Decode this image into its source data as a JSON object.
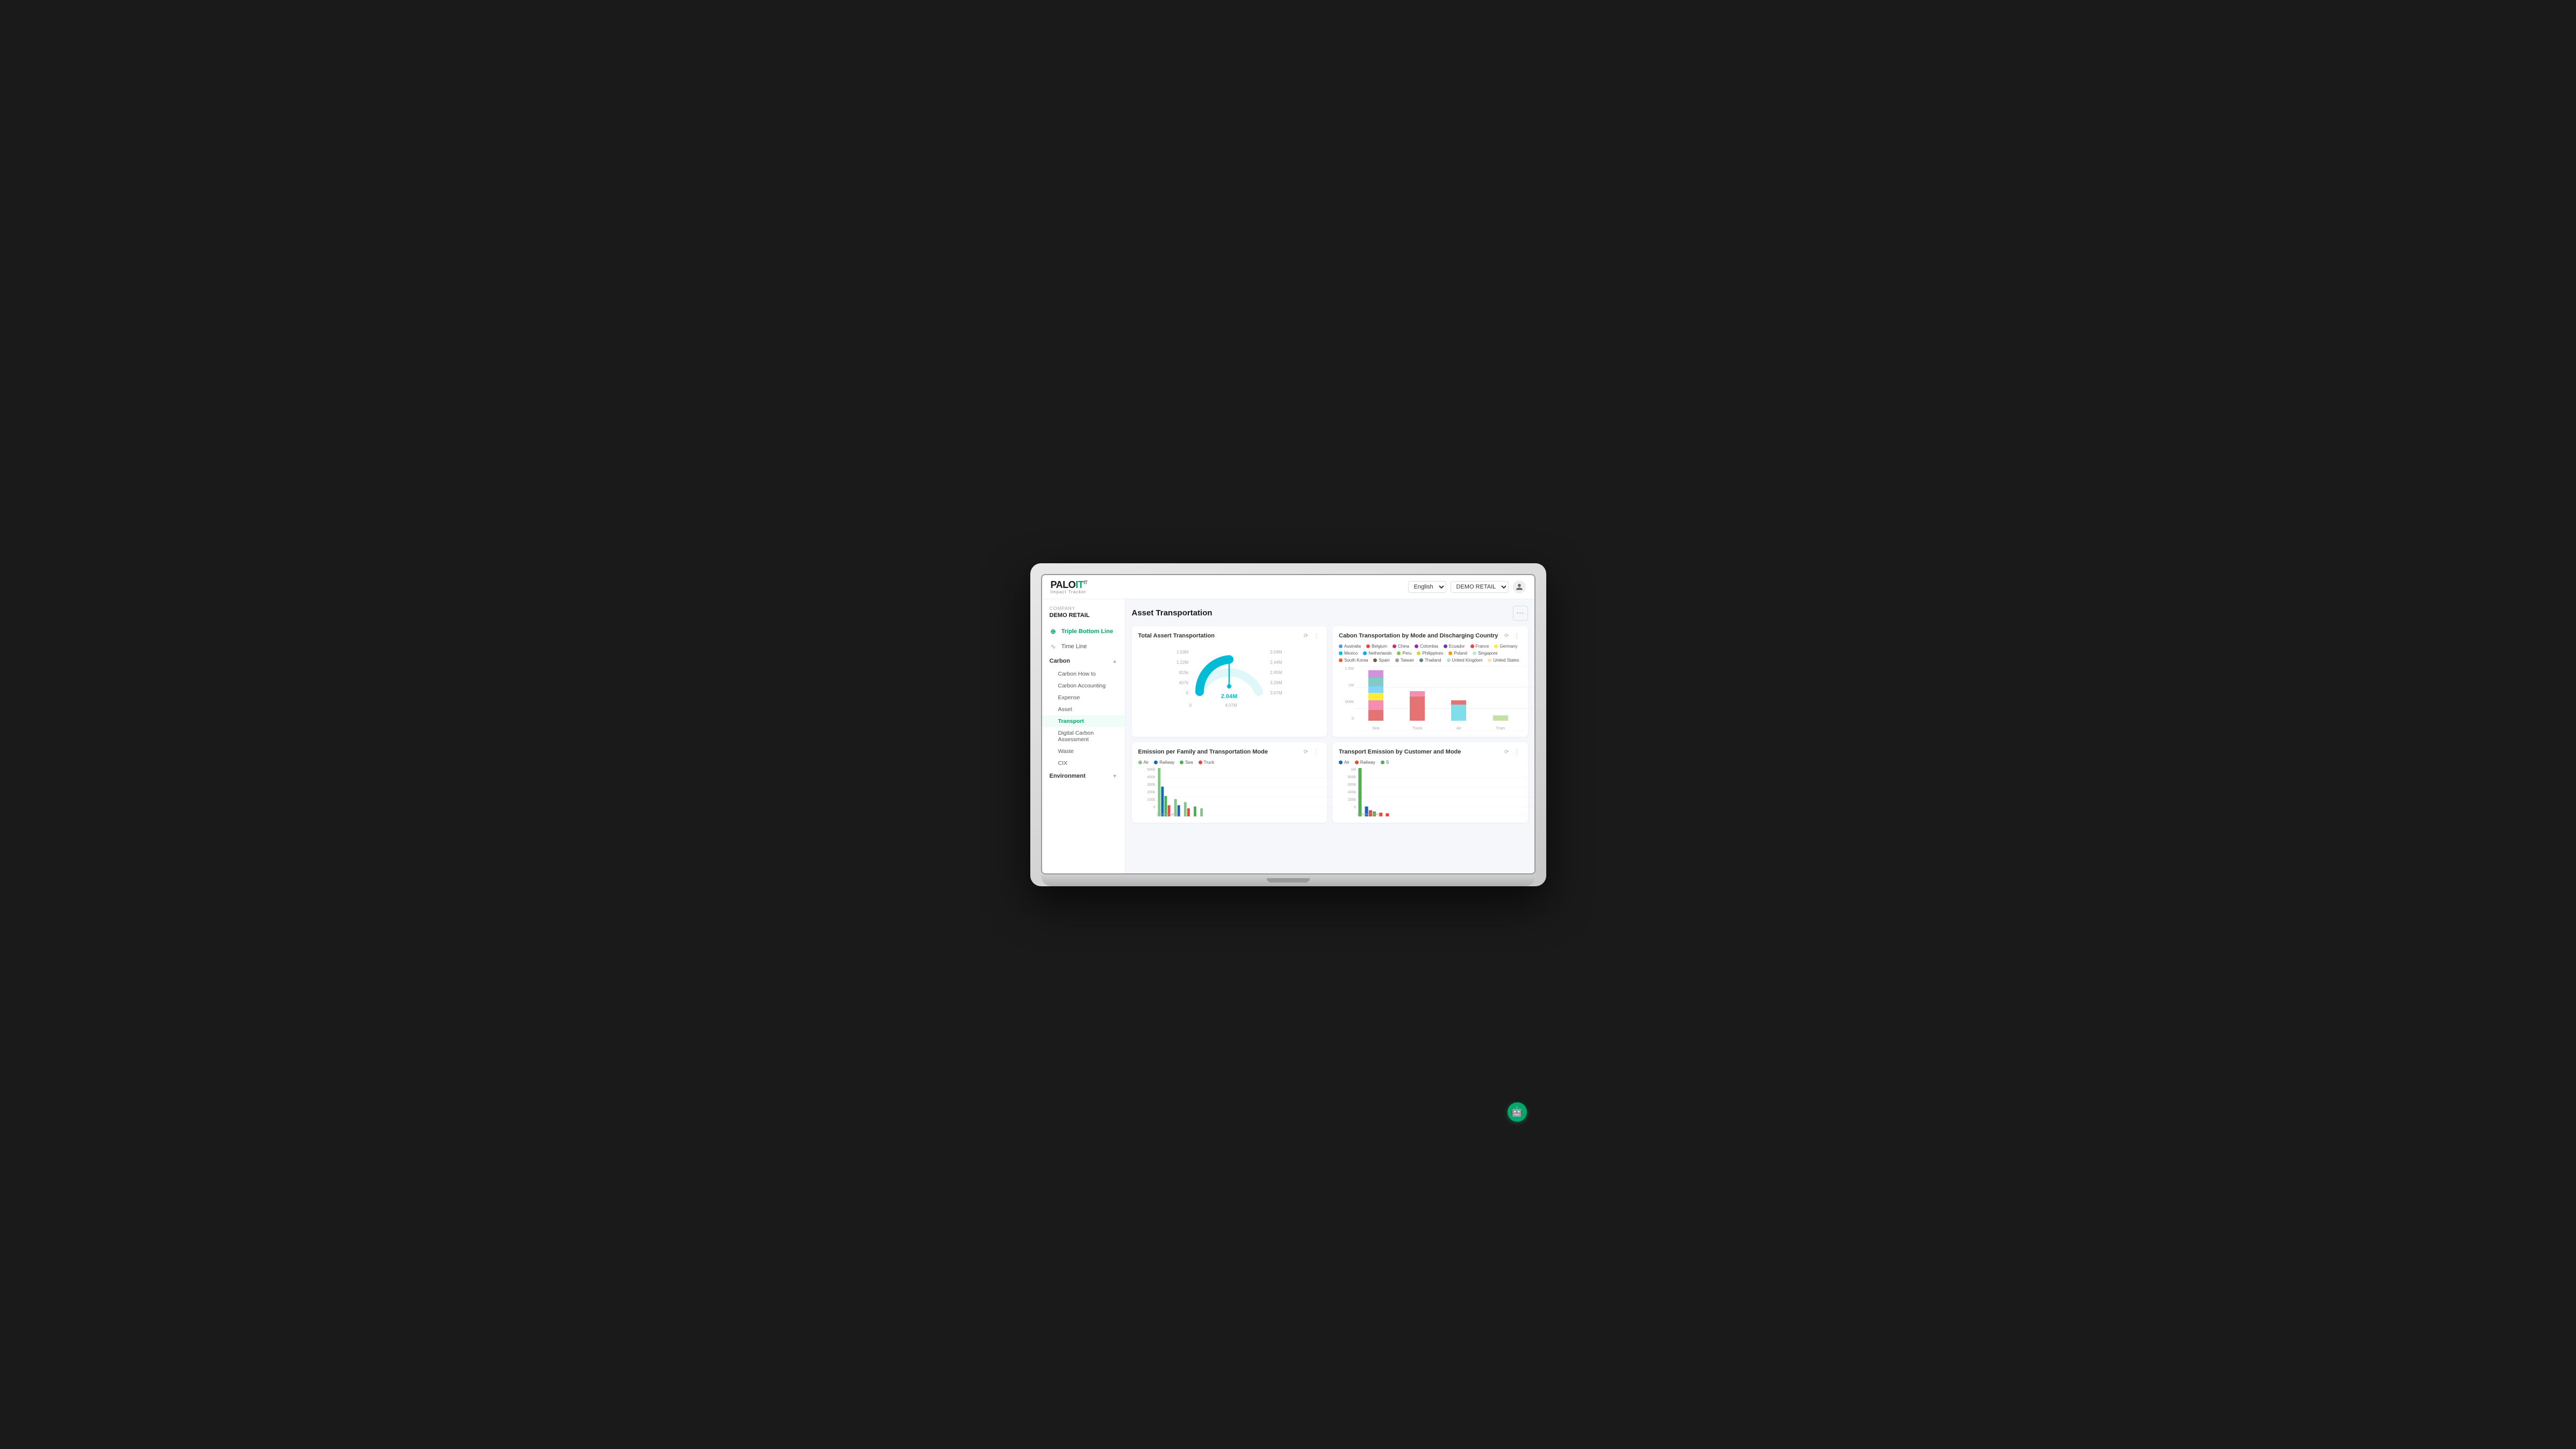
{
  "header": {
    "logo": "PALO IT",
    "logo_palo": "PALO",
    "logo_it": "IT",
    "subtitle": "Impact Tracker",
    "lang_label": "English",
    "company_label": "DEMO RETAIL",
    "user_icon": "👤"
  },
  "sidebar": {
    "company_label": "Company",
    "company_name": "DEMO RETAIL",
    "items": [
      {
        "id": "triple-bottom-line",
        "label": "Triple Bottom Line",
        "icon": "⊕",
        "active": true
      },
      {
        "id": "timeline",
        "label": "Time Line",
        "icon": "∿"
      }
    ],
    "carbon_section": {
      "label": "Carbon",
      "sub_items": [
        {
          "id": "carbon-how-to",
          "label": "Carbon How to"
        },
        {
          "id": "carbon-accounting",
          "label": "Carbon Accounting"
        },
        {
          "id": "expense",
          "label": "Expense"
        },
        {
          "id": "asset",
          "label": "Asset"
        },
        {
          "id": "transport",
          "label": "Transport",
          "active": true
        },
        {
          "id": "digital-carbon",
          "label": "Digital Carbon Assessment"
        },
        {
          "id": "waste",
          "label": "Waste"
        },
        {
          "id": "cix",
          "label": "CIX"
        }
      ]
    },
    "environment_section": {
      "label": "Environment"
    }
  },
  "main": {
    "title": "Asset Transportation",
    "charts": {
      "total_assert": {
        "title": "Total Assert Transportation",
        "center_value": "2.04M",
        "gauge_labels": {
          "label_0": "0",
          "label_407k": "407k",
          "label_815k": "815k",
          "label_122m": "1.22M",
          "label_163m": "1.63M",
          "label_204m": "2.04M",
          "label_244m": "2.44M",
          "label_285m": "2.85M",
          "label_326m": "3.26M",
          "label_367m": "3.67M",
          "label_407m": "4.07M"
        }
      },
      "cabon_transportation": {
        "title": "Cabon Transportation by Mode and Discharging Country",
        "legend": [
          {
            "label": "Australia",
            "color": "#4e9af1"
          },
          {
            "label": "Belgium",
            "color": "#f44336"
          },
          {
            "label": "China",
            "color": "#e91e63"
          },
          {
            "label": "Colombia",
            "color": "#9c27b0"
          },
          {
            "label": "Ecuador",
            "color": "#673ab7"
          },
          {
            "label": "France",
            "color": "#f44336"
          },
          {
            "label": "Germany",
            "color": "#ffeb3b"
          },
          {
            "label": "Mexico",
            "color": "#00bcd4"
          },
          {
            "label": "Netherlands",
            "color": "#03a9f4"
          },
          {
            "label": "Peru",
            "color": "#8bc34a"
          },
          {
            "label": "Philippines",
            "color": "#cddc39"
          },
          {
            "label": "Poland",
            "color": "#ff9800"
          },
          {
            "label": "Singapore",
            "color": "#c8e6c9"
          },
          {
            "label": "South Korea",
            "color": "#ff5722"
          },
          {
            "label": "Spain",
            "color": "#795548"
          },
          {
            "label": "Taiwan",
            "color": "#9e9e9e"
          },
          {
            "label": "Thailand",
            "color": "#607d8b"
          },
          {
            "label": "United Kingdom",
            "color": "#b2dfdb"
          },
          {
            "label": "United States",
            "color": "#ffe0b2"
          }
        ],
        "y_labels": [
          "1.5M",
          "1M",
          "500k",
          "0"
        ],
        "x_labels": [
          "Sea",
          "Truck",
          "Air",
          "Train"
        ],
        "bars": [
          {
            "label": "Sea",
            "segments": [
              {
                "color": "#e57373",
                "height": 45
              },
              {
                "color": "#ffeb3b",
                "height": 18
              },
              {
                "color": "#81d4fa",
                "height": 22
              },
              {
                "color": "#80cbc4",
                "height": 15
              },
              {
                "color": "#ce93d8",
                "height": 20
              },
              {
                "color": "#ef9a9a",
                "height": 12
              }
            ]
          },
          {
            "label": "Truck",
            "segments": [
              {
                "color": "#e57373",
                "height": 55
              },
              {
                "color": "#f48fb1",
                "height": 10
              }
            ]
          },
          {
            "label": "Air",
            "segments": [
              {
                "color": "#80deea",
                "height": 42
              },
              {
                "color": "#e57373",
                "height": 8
              }
            ]
          },
          {
            "label": "Train",
            "segments": [
              {
                "color": "#c5e1a5",
                "height": 12
              }
            ]
          }
        ]
      },
      "emission_family": {
        "title": "Emission per Family and Transportation Mode",
        "legend": [
          {
            "label": "Air",
            "color": "#81c784"
          },
          {
            "label": "Railway",
            "color": "#1565c0"
          },
          {
            "label": "Sea",
            "color": "#4caf50"
          },
          {
            "label": "Truck",
            "color": "#f44336"
          }
        ],
        "y_labels": [
          "500k",
          "400k",
          "300k",
          "200k",
          "100k",
          "0"
        ]
      },
      "transport_emission": {
        "title": "Transport Emission by Customer and Mode",
        "legend": [
          {
            "label": "Air",
            "color": "#1565c0"
          },
          {
            "label": "Railway",
            "color": "#f44336"
          },
          {
            "label": "S",
            "color": "#4caf50"
          }
        ],
        "y_labels": [
          "1M",
          "800k",
          "600k",
          "400k",
          "200k",
          "0"
        ]
      }
    }
  },
  "chatbot": {
    "icon": "🤖"
  },
  "more_icon": "⋯"
}
